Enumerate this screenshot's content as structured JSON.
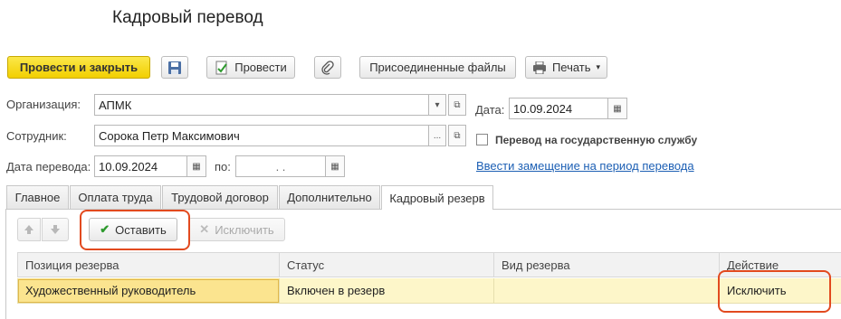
{
  "window": {
    "title": "Кадровый перевод"
  },
  "toolbar": {
    "post_close_label": "Провести и закрыть",
    "save_icon": "floppy-disk-icon",
    "post_label": "Провести",
    "attach_icon": "paperclip-icon",
    "files_label": "Присоединенные файлы",
    "print_label": "Печать"
  },
  "form": {
    "org_label": "Организация:",
    "org_value": "АПМК",
    "employee_label": "Сотрудник:",
    "employee_value": "Сорока Петр Максимович",
    "transfer_date_label": "Дата перевода:",
    "transfer_date_value": "10.09.2024",
    "to_label": "по:",
    "to_value": ". .",
    "date_label": "Дата:",
    "date_value": "10.09.2024",
    "civil_service_label": "Перевод на государственную службу",
    "civil_service_checked": false,
    "replacement_link": "Ввести замещение на период перевода"
  },
  "tabs": [
    {
      "label": "Главное"
    },
    {
      "label": "Оплата труда"
    },
    {
      "label": "Трудовой договор"
    },
    {
      "label": "Дополнительно"
    },
    {
      "label": "Кадровый резерв",
      "active": true
    }
  ],
  "reserve": {
    "keep_label": "Оставить",
    "exclude_label": "Исключить",
    "columns": [
      "Позиция резерва",
      "Статус",
      "Вид резерва",
      "Действие"
    ],
    "rows": [
      {
        "position": "Художественный руководитель",
        "status": "Включен в резерв",
        "kind": "",
        "action": "Исключить"
      }
    ]
  },
  "colors": {
    "primary_button": "#f2cf00",
    "highlight": "#e24a1f",
    "selected_row": "#fdf6c9",
    "link": "#1c5fb4"
  }
}
